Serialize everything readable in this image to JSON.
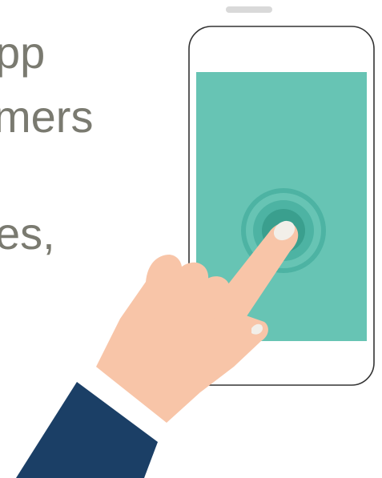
{
  "background_text": {
    "fragments": [
      "pp",
      "mers",
      "es,"
    ]
  },
  "illustration": {
    "description_icon": "hand-tapping-smartphone-icon",
    "colors": {
      "phone_outline": "#333333",
      "phone_body": "#ffffff",
      "screen": "#67c4b4",
      "ring_outer": "#4db3a3",
      "ring_center": "#3a9f8e",
      "skin": "#f8c5a8",
      "fingernail": "#f2efe9",
      "sleeve": "#1b3f66",
      "cuff": "#ffffff",
      "speaker": "#d9d9d9"
    }
  }
}
